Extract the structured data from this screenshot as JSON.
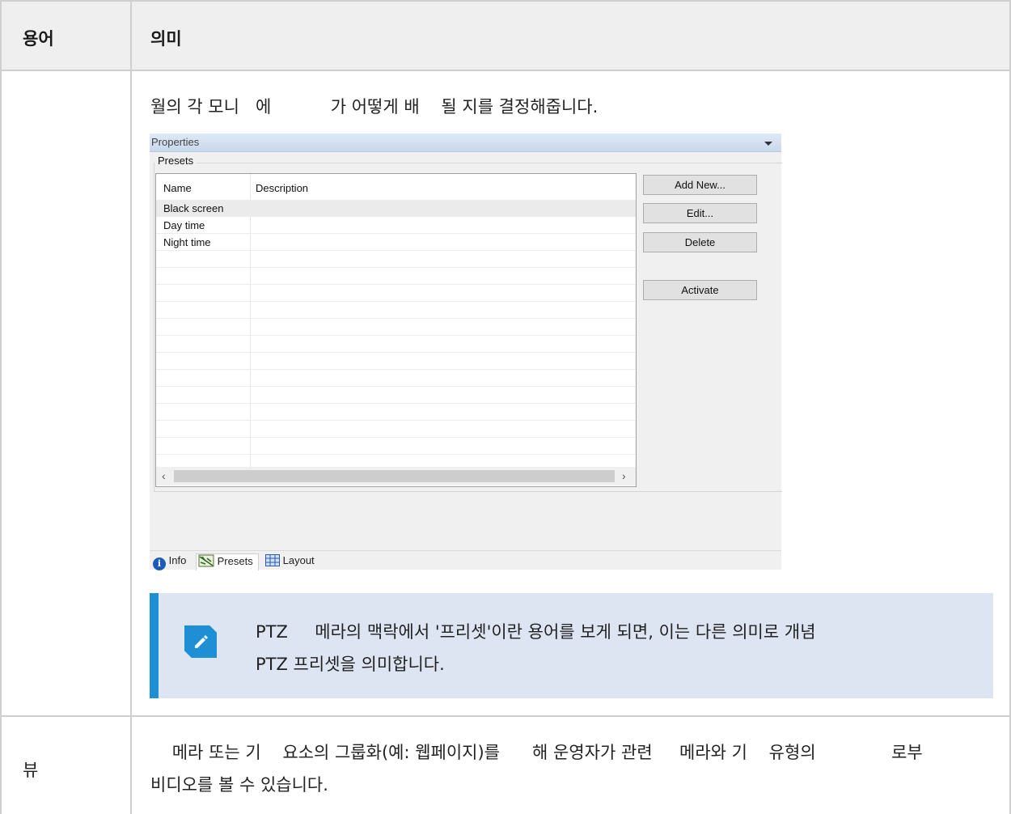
{
  "table": {
    "header": {
      "col1": "용어",
      "col2": "의미"
    },
    "row1": {
      "description": "월의 각 모니   에           가 어떻게 배    될 지를 결정해줍니다.",
      "note": {
        "line1": "PTZ     메라의 맥락에서 '프리셋'이란 용어를 보게 되면, 이는 다른 의미로 개념",
        "line2": "PTZ 프리셋을 의미합니다."
      }
    },
    "row2": {
      "term": "뷰",
      "line1": "    메라 또는 기    요소의 그룹화(예: 웹페이지)를      해 운영자가 관련     메라와 기    유형의              로부",
      "line2": "비디오를 볼 수 있습니다."
    }
  },
  "screenshot": {
    "title": "Properties",
    "group_label": "Presets",
    "columns": [
      "Name",
      "Description"
    ],
    "rows": [
      "Black screen",
      "Day time",
      "Night time"
    ],
    "buttons": {
      "add_new": "Add New...",
      "edit": "Edit...",
      "delete": "Delete",
      "activate": "Activate"
    },
    "tabs": {
      "info": "Info",
      "presets": "Presets",
      "layout": "Layout"
    }
  },
  "icons": {
    "note": "pencil-edit-icon",
    "info_tab": "info-icon",
    "presets_tab": "presets-icon",
    "layout_tab": "grid-layout-icon"
  },
  "colors": {
    "note_background": "#dde5f3",
    "note_accent": "#1e8fd4",
    "header_background": "#efefef"
  }
}
